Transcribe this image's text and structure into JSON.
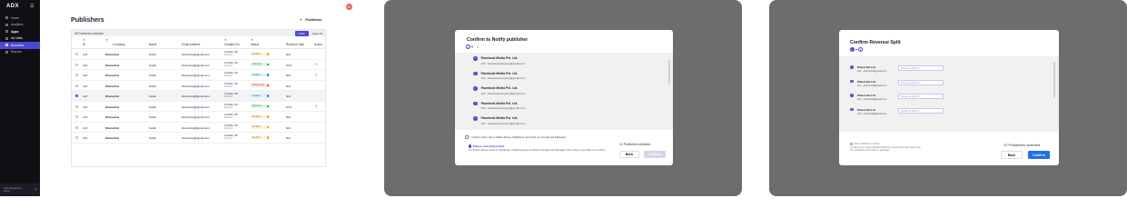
{
  "sidebar": {
    "logo": "ADX",
    "items": [
      {
        "label": "Home"
      },
      {
        "label": "Analytics"
      },
      {
        "label": "Apps"
      },
      {
        "label": "Ad Units"
      },
      {
        "label": "Accounts"
      },
      {
        "label": "Reports"
      }
    ],
    "footer_line1": "ADX Management",
    "footer_line2": "Admin"
  },
  "publishers": {
    "title": "Publishers",
    "add_button": "Publisher",
    "selected_text": "05 Publishers selected",
    "notify_button": "Notify",
    "clear_button": "Clear All",
    "columns": [
      "ID",
      "Company",
      "Name",
      "Email Address",
      "Created On",
      "Status",
      "Revenue Split",
      "Action"
    ],
    "rows": [
      {
        "id": "123",
        "company": "Sharechat",
        "name": "Kartik",
        "email": "sharechat@gmail.com",
        "date": "12 Mar, 20",
        "time": "4:15 pm",
        "status": "Pending",
        "revenue": "N/A",
        "selected": false,
        "edit": false
      },
      {
        "id": "123",
        "company": "Sharechat",
        "name": "Kartik",
        "email": "sharechat@gmail.com",
        "date": "12 Mar, 20",
        "time": "4:15 pm",
        "status": "Approved",
        "revenue": "67%",
        "selected": false,
        "edit": true
      },
      {
        "id": "123",
        "company": "Sharechat",
        "name": "Kartik",
        "email": "sharechat@gmail.com",
        "date": "12 Mar, 20",
        "time": "4:15 pm",
        "status": "Created",
        "revenue": "N/A",
        "selected": false,
        "edit": true
      },
      {
        "id": "123",
        "company": "Sharechat",
        "name": "Kartik",
        "email": "sharechat@gmail.com",
        "date": "12 Mar, 20",
        "time": "4:15 pm",
        "status": "Disapproved",
        "revenue": "N/A",
        "selected": false,
        "edit": false
      },
      {
        "id": "123",
        "company": "Sharechat",
        "name": "Kartik",
        "email": "sharechat@gmail.com",
        "date": "12 Mar, 20",
        "time": "4:15 pm",
        "status": "Created",
        "revenue": "N/A",
        "selected": true,
        "edit": false
      },
      {
        "id": "123",
        "company": "Sharechat",
        "name": "Kartik",
        "email": "sharechat@gmail.com",
        "date": "12 Mar, 20",
        "time": "4:15 pm",
        "status": "Approved",
        "revenue": "67%",
        "selected": false,
        "edit": true
      },
      {
        "id": "123",
        "company": "Sharechat",
        "name": "Kartik",
        "email": "sharechat@gmail.com",
        "date": "12 Mar, 20",
        "time": "4:15 pm",
        "status": "Pending",
        "revenue": "N/A",
        "selected": false,
        "edit": false
      },
      {
        "id": "123",
        "company": "Sharechat",
        "name": "Kartik",
        "email": "sharechat@gmail.com",
        "date": "12 Mar, 20",
        "time": "4:15 pm",
        "status": "Pending",
        "revenue": "N/A",
        "selected": false,
        "edit": false
      },
      {
        "id": "123",
        "company": "Sharechat",
        "name": "Kartik",
        "email": "sharechat@gmail.com",
        "date": "12 Mar, 20",
        "time": "4:15 pm",
        "status": "Pending",
        "revenue": "N/A",
        "selected": false,
        "edit": false
      }
    ]
  },
  "recording_badge": "02",
  "notify_modal": {
    "title": "Confirm to Notify publisher",
    "steps": [
      "1",
      "2"
    ],
    "publishers": [
      {
        "name": "Facebook Media Pvt. Ltd.",
        "email": "123 - facebookcompany@gmail.com"
      },
      {
        "name": "Facebook Media Pvt. Ltd.",
        "email": "123 - facebookcompany@gmail.com"
      },
      {
        "name": "Facebook Media Pvt. Ltd.",
        "email": "123 - facebookcompany@gmail.com"
      },
      {
        "name": "Facebook Media Pvt. Ltd.",
        "email": "123 - facebookcompany@gmail.com"
      },
      {
        "name": "Facebook Media Pvt. Ltd.",
        "email": "123 - facebookcompany@gmail.com"
      }
    ],
    "confirm_checkbox": "I confirm that i have added these publishers accounts on Google Ad Manager",
    "note_title": "Please read (Important)",
    "note_body": "An Email will be send to publisher notifying them to fill the Google Ad Manager form when you click on confirm.",
    "selected_count": "12 Publishers selected",
    "back": "Back",
    "confirm": "Confirm"
  },
  "revenue_modal": {
    "title": "Confirm Revenue Split",
    "steps": [
      "1",
      "2"
    ],
    "publishers": [
      {
        "name": "Sharechat Ltd.",
        "email": "123 - sharechat@gmail.com",
        "split_placeholder": "Revenue Split %"
      },
      {
        "name": "Sharechat Ltd.",
        "email": "123 - sharechat@gmail.com",
        "split_placeholder": "Revenue Split %"
      },
      {
        "name": "Sharechat Ltd.",
        "email": "123 - sharechat@gmail.com",
        "split_placeholder": "Revenue Split %"
      },
      {
        "name": "Sharechat Ltd.",
        "email": "123 - sharechat@gmail.com",
        "split_placeholder": "Revenue Split %"
      }
    ],
    "note_line1": "Once clicked on Confirm",
    "note_line2": "A mail is sent to the publisher that their account has been approved.",
    "note_line3": "The publisher will be able to add apps.",
    "selected_count": "12 Publishers selected",
    "back": "Back",
    "confirm": "Confirm"
  },
  "colors": {
    "accent": "#4b49d6",
    "confirm_blue": "#1f6feb",
    "sidebar": "#0f0f14",
    "overlay": "#6d6d6d"
  }
}
